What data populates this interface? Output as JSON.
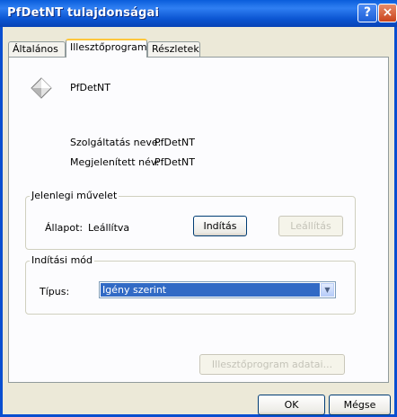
{
  "window": {
    "title": "PfDetNT tulajdonságai",
    "help_label": "?",
    "close_label": "×"
  },
  "tabs": [
    {
      "label": "Általános",
      "active": false
    },
    {
      "label": "Illesztőprogram",
      "active": true
    },
    {
      "label": "Részletek",
      "active": false
    }
  ],
  "service": {
    "icon": "diamond-icon",
    "name": "PfDetNT",
    "service_name_label": "Szolgáltatás neve:",
    "service_name_value": "PfDetNT",
    "display_name_label": "Megjelenített név:",
    "display_name_value": "PfDetNT"
  },
  "current_operation": {
    "legend": "Jelenlegi művelet",
    "status_label": "Állapot:",
    "status_value": "Leállítva",
    "start_button": "Indítás",
    "stop_button": "Leállítás"
  },
  "startup_mode": {
    "legend": "Indítási mód",
    "type_label": "Típus:",
    "type_value": "Igény szerint"
  },
  "driver_details_button": "Illesztőprogram adatai...",
  "footer": {
    "ok": "OK",
    "cancel": "Mégse"
  },
  "colors": {
    "titlebar": "#0a5ddb",
    "selection": "#316ac5",
    "dialog_bg": "#ece9d8"
  }
}
